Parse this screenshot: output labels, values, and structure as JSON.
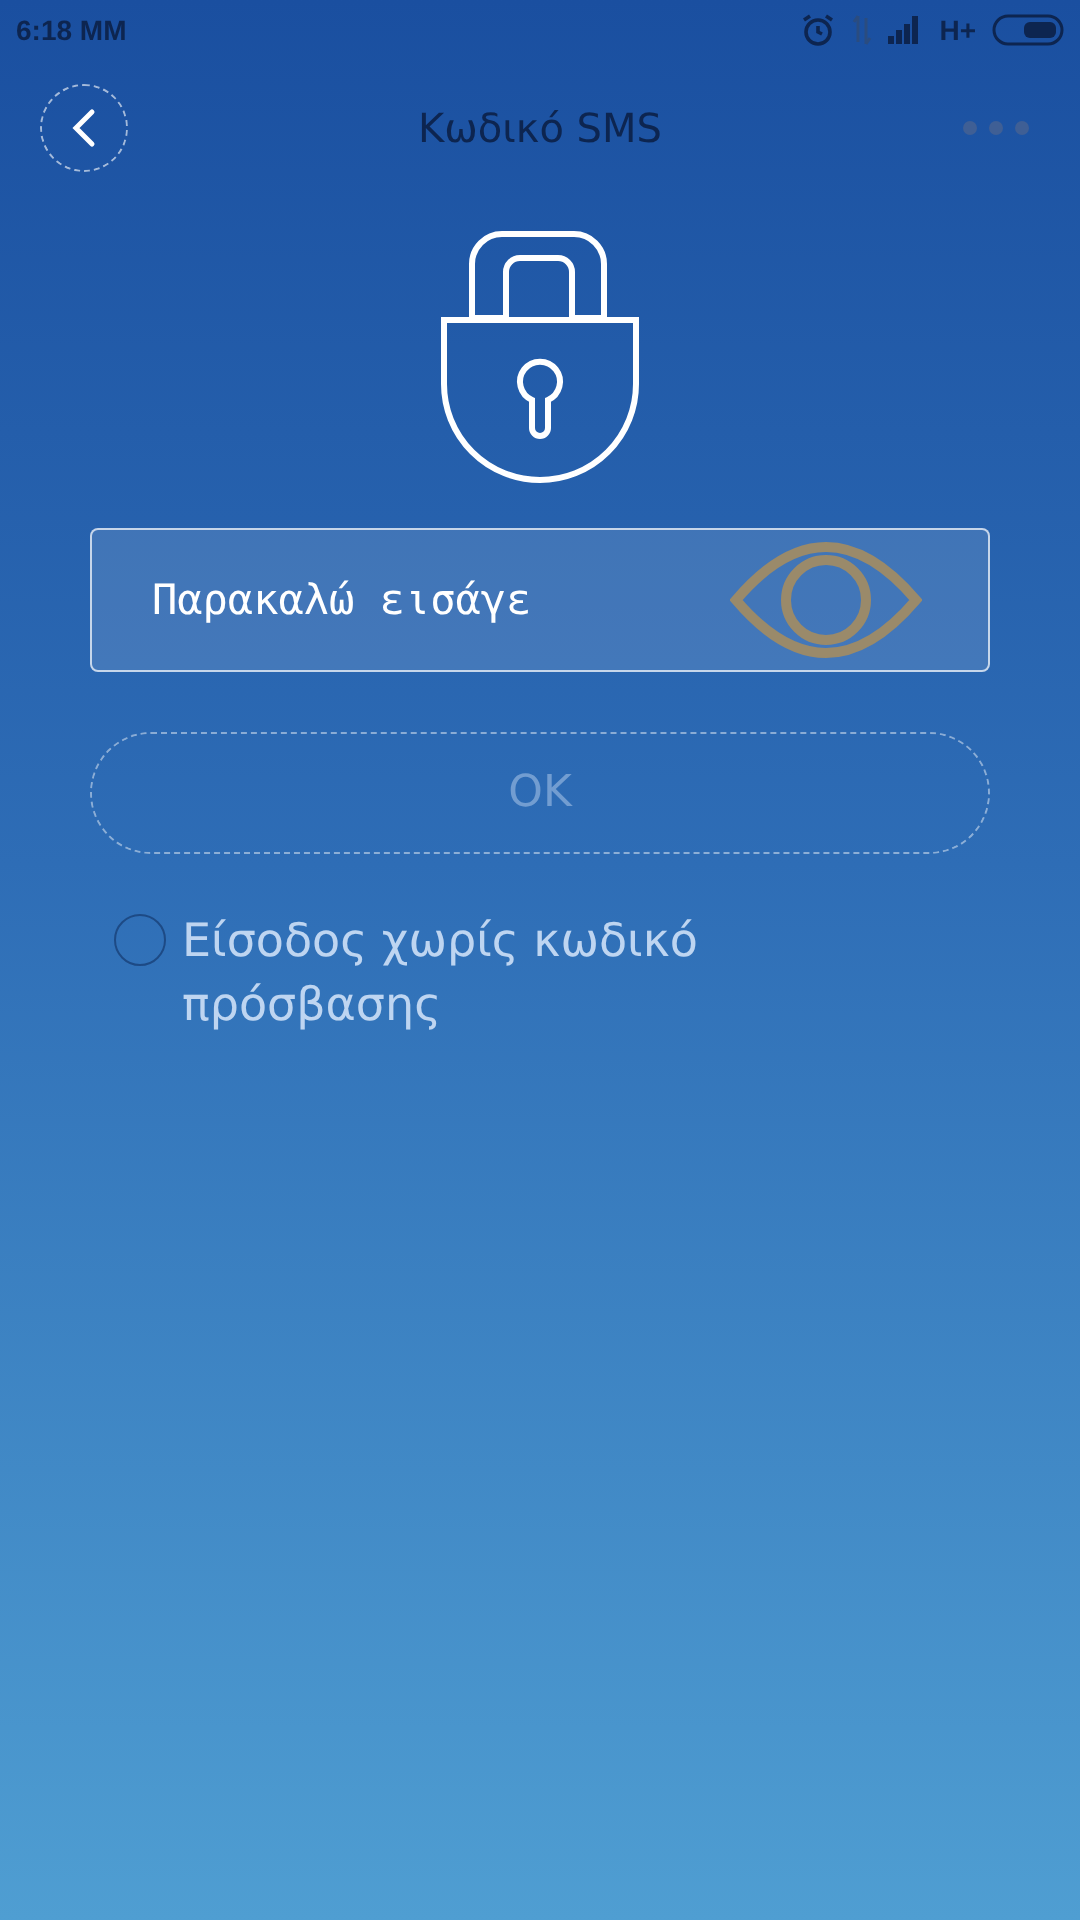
{
  "status_bar": {
    "time": "6:18 MM",
    "network": "H+"
  },
  "header": {
    "title": "Κωδικό SMS"
  },
  "code_field": {
    "placeholder": "Παρακαλώ εισάγε"
  },
  "ok_button": {
    "label": "OK",
    "disabled": true
  },
  "passwordless_option": {
    "label": "Είσοδος χωρίς κωδικό πρόσβασης",
    "checked": false
  }
}
